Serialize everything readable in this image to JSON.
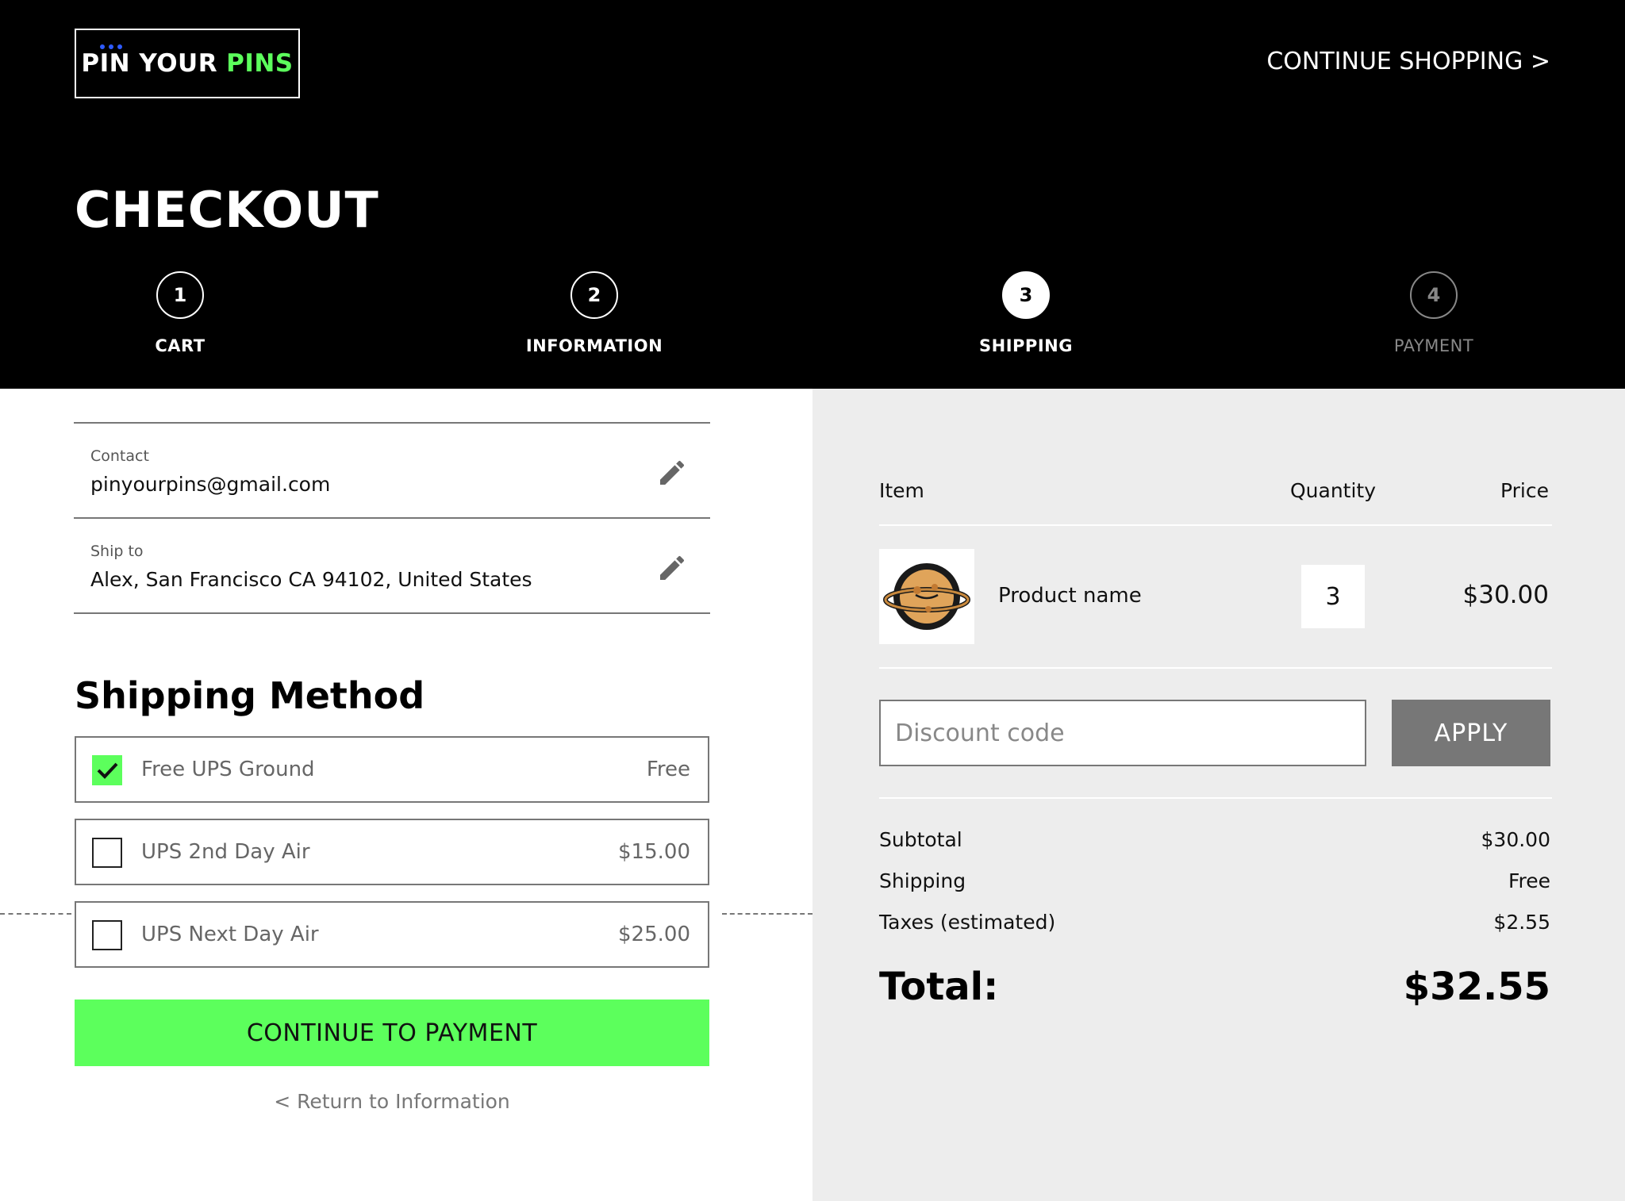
{
  "brand": {
    "word1": "PIN YOUR",
    "word2": "PINS"
  },
  "header": {
    "continue_shopping": "CONTINUE SHOPPING >",
    "title": "CHECKOUT"
  },
  "steps": [
    {
      "number": "1",
      "label": "CART",
      "state": "done"
    },
    {
      "number": "2",
      "label": "INFORMATION",
      "state": "done"
    },
    {
      "number": "3",
      "label": "SHIPPING",
      "state": "active"
    },
    {
      "number": "4",
      "label": "PAYMENT",
      "state": "pending"
    }
  ],
  "contact": {
    "label": "Contact",
    "value": "pinyourpins@gmail.com"
  },
  "ship_to": {
    "label": "Ship to",
    "value": "Alex, San Francisco CA 94102, United States"
  },
  "shipping_method": {
    "title": "Shipping Method",
    "options": [
      {
        "name": "Free UPS Ground",
        "price": "Free",
        "checked": true
      },
      {
        "name": "UPS 2nd Day Air",
        "price": "$15.00",
        "checked": false
      },
      {
        "name": "UPS Next Day Air",
        "price": "$25.00",
        "checked": false
      }
    ]
  },
  "actions": {
    "continue_label": "CONTINUE TO PAYMENT",
    "back_label": "< Return to Information"
  },
  "summary": {
    "columns": {
      "item": "Item",
      "quantity": "Quantity",
      "price": "Price"
    },
    "product": {
      "name": "Product name",
      "quantity": "3",
      "price": "$30.00",
      "thumb_icon": "planet-pin-icon"
    },
    "discount": {
      "placeholder": "Discount code",
      "apply_label": "APPLY"
    },
    "subtotal": {
      "label": "Subtotal",
      "value": "$30.00"
    },
    "shipping": {
      "label": "Shipping",
      "value": "Free"
    },
    "taxes": {
      "label": "Taxes (estimated)",
      "value": "$2.55"
    },
    "total": {
      "label": "Total:",
      "value": "$32.55"
    }
  },
  "colors": {
    "accent": "#5cff5c",
    "header_bg": "#000000",
    "summary_bg": "#ededed",
    "logo_dots": "#2e5bff"
  }
}
